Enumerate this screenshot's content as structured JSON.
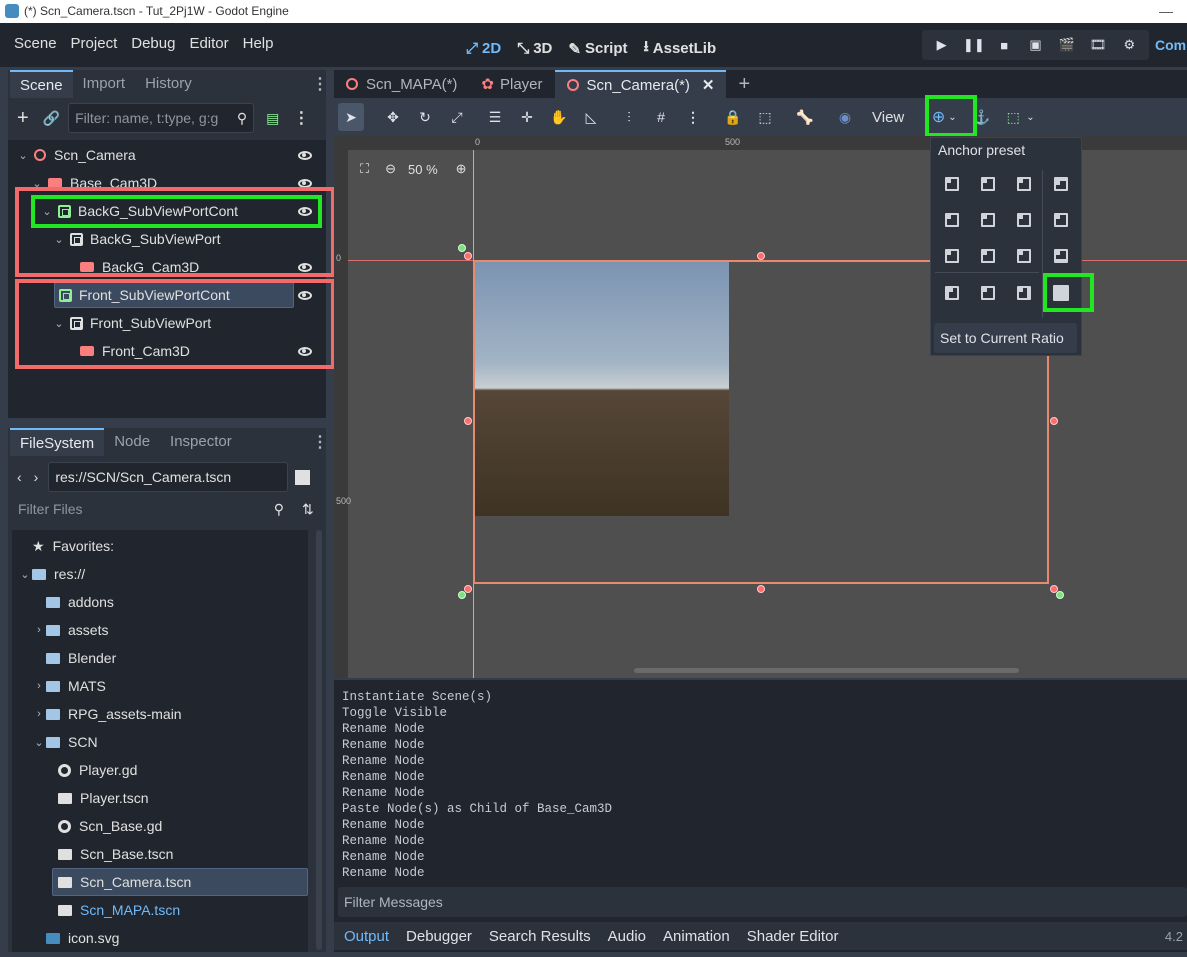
{
  "title_bar": {
    "title": "(*) Scn_Camera.tscn - Tut_2Pj1W - Godot Engine",
    "minimize": "—"
  },
  "menu": {
    "items": [
      "Scene",
      "Project",
      "Debug",
      "Editor",
      "Help"
    ]
  },
  "workspaces": {
    "w2d": "2D",
    "w3d": "3D",
    "script": "Script",
    "assetlib": "AssetLib",
    "renderer": "Com"
  },
  "run_buttons": [
    "play",
    "pause",
    "stop",
    "remote",
    "play-scene",
    "play-custom",
    "movie"
  ],
  "scene_dock": {
    "tabs": [
      "Scene",
      "Import",
      "History"
    ],
    "active_tab": "Scene",
    "filter_placeholder": "Filter: name, t:type, g:g",
    "nodes": [
      {
        "name": "Scn_Camera",
        "type": "Node"
      },
      {
        "name": "Base_Cam3D",
        "type": "Camera"
      },
      {
        "name": "BackG_SubViewPortCont",
        "type": "Control"
      },
      {
        "name": "BackG_SubViewPort",
        "type": "Viewport"
      },
      {
        "name": "BackG_Cam3D",
        "type": "Camera"
      },
      {
        "name": "Front_SubViewPortCont",
        "type": "Control"
      },
      {
        "name": "Front_SubViewPort",
        "type": "Viewport"
      },
      {
        "name": "Front_Cam3D",
        "type": "Camera"
      }
    ]
  },
  "filesystem_dock": {
    "tabs": [
      "FileSystem",
      "Node",
      "Inspector"
    ],
    "path": "res://SCN/Scn_Camera.tscn",
    "filter_placeholder": "Filter Files",
    "favorites": "Favorites:",
    "items": [
      {
        "label": "res://",
        "kind": "folder"
      },
      {
        "label": "addons",
        "kind": "folder"
      },
      {
        "label": "assets",
        "kind": "folder"
      },
      {
        "label": "Blender",
        "kind": "folder"
      },
      {
        "label": "MATS",
        "kind": "folder"
      },
      {
        "label": "RPG_assets-main",
        "kind": "folder"
      },
      {
        "label": "SCN",
        "kind": "folder"
      },
      {
        "label": "Player.gd",
        "kind": "script"
      },
      {
        "label": "Player.tscn",
        "kind": "scene"
      },
      {
        "label": "Scn_Base.gd",
        "kind": "script"
      },
      {
        "label": "Scn_Base.tscn",
        "kind": "scene"
      },
      {
        "label": "Scn_Camera.tscn",
        "kind": "scene"
      },
      {
        "label": "Scn_MAPA.tscn",
        "kind": "scene"
      },
      {
        "label": "icon.svg",
        "kind": "image"
      }
    ]
  },
  "editor_tabs": [
    {
      "label": "Scn_MAPA(*)"
    },
    {
      "label": "Player"
    },
    {
      "label": "Scn_Camera(*)"
    }
  ],
  "toolbar": {
    "view_label": "View"
  },
  "viewport": {
    "zoom": "50 %",
    "ruler_top": [
      "0",
      "500"
    ],
    "ruler_left": [
      "0",
      "500"
    ]
  },
  "anchor_popup": {
    "title": "Anchor preset",
    "set_ratio": "Set to Current Ratio"
  },
  "output_log": {
    "lines": [
      "Instantiate Scene(s)",
      "Toggle Visible",
      "Rename Node",
      "Rename Node",
      "Rename Node",
      "Rename Node",
      "Rename Node",
      "Paste Node(s) as Child of Base_Cam3D",
      "Rename Node",
      "Rename Node",
      "Rename Node",
      "Rename Node"
    ],
    "filter_placeholder": "Filter Messages"
  },
  "bottom_tabs": [
    "Output",
    "Debugger",
    "Search Results",
    "Audio",
    "Animation",
    "Shader Editor"
  ],
  "version": "4.2",
  "colors": {
    "accent": "#70bafa",
    "highlight_green": "#22e622",
    "highlight_red": "#f26a6a"
  }
}
